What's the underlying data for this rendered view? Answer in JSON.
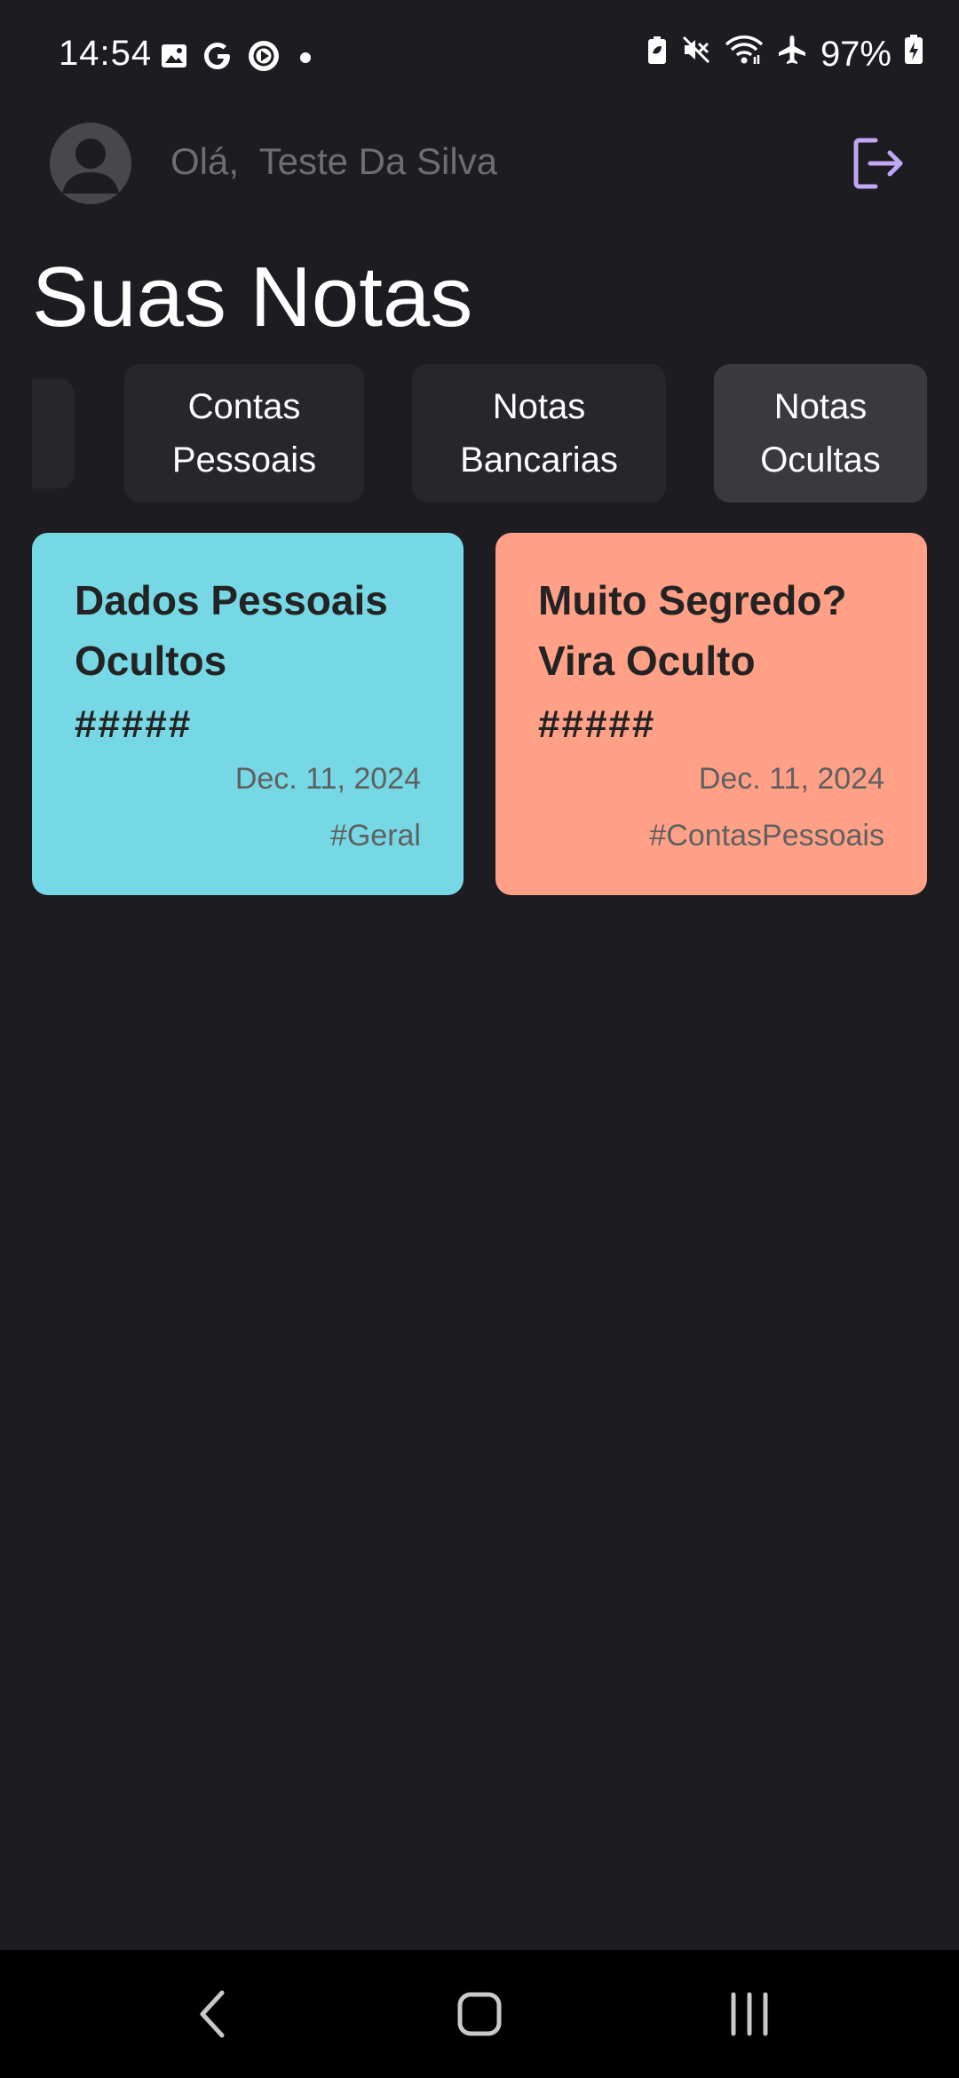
{
  "status_bar": {
    "time": "14:54",
    "left_icons": [
      "gallery-icon",
      "google-icon",
      "play-circle-icon",
      "dot-icon"
    ],
    "right_icons": [
      "battery-saver-icon",
      "mute-icon",
      "wifi-icon",
      "airplane-icon"
    ],
    "battery_percent": "97%"
  },
  "header": {
    "greeting": "Olá,  Teste Da Silva",
    "avatar_icon": "person-icon",
    "logout_icon": "logout-icon",
    "accent_color": "#c2a7f5"
  },
  "page": {
    "title": "Suas Notas"
  },
  "categories": [
    {
      "label_line1": "",
      "label_line2": "",
      "selected": false
    },
    {
      "label_line1": "Contas",
      "label_line2": "Pessoais",
      "selected": false
    },
    {
      "label_line1": "Notas",
      "label_line2": "Bancarias",
      "selected": false
    },
    {
      "label_line1": "Notas",
      "label_line2": "Ocultas",
      "selected": true
    }
  ],
  "notes": [
    {
      "title": "Dados Pessoais Ocultos",
      "body": "#####",
      "date": "Dec. 11, 2024",
      "tag": "#Geral",
      "color": "#77d8e5"
    },
    {
      "title": "Muito Segredo? Vira Oculto",
      "body": "#####",
      "date": "Dec. 11, 2024",
      "tag": "#ContasPessoais",
      "color": "#ffa087"
    }
  ],
  "nav_bar": {
    "back_icon": "back-icon",
    "home_icon": "home-icon",
    "recents_icon": "recents-icon"
  }
}
